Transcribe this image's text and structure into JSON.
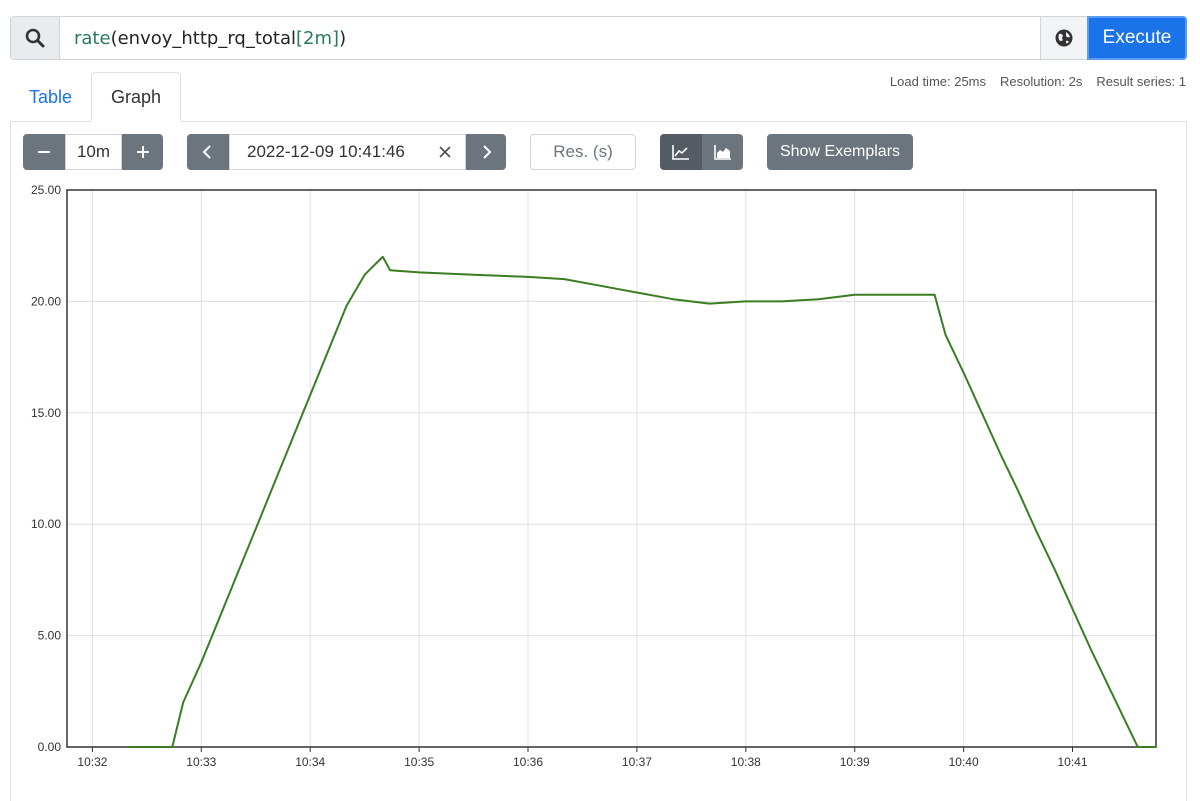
{
  "query": {
    "func": "rate",
    "open_paren": "(",
    "metric": "envoy_http_rq_total",
    "open_bracket": "[",
    "duration": "2m",
    "close_bracket": "]",
    "close_paren": ")"
  },
  "execute_label": "Execute",
  "tabs": {
    "table": "Table",
    "graph": "Graph"
  },
  "stats": {
    "load_time": "Load time: 25ms",
    "resolution": "Resolution: 2s",
    "result_series": "Result series: 1"
  },
  "controls": {
    "range_value": "10m",
    "end_time": "2022-12-09 10:41:46",
    "resolution_placeholder": "Res. (s)",
    "show_exemplars": "Show Exemplars"
  },
  "colors": {
    "series": "#3a7d22",
    "accent": "#1a73e8",
    "button": "#6c757d"
  },
  "chart_data": {
    "type": "line",
    "x_ticks": [
      "10:32",
      "10:33",
      "10:34",
      "10:35",
      "10:36",
      "10:37",
      "10:38",
      "10:39",
      "10:40",
      "10:41"
    ],
    "y_ticks": [
      "0.00",
      "5.00",
      "10.00",
      "15.00",
      "20.00",
      "25.00"
    ],
    "ylim": [
      0,
      25
    ],
    "xlim": [
      "10:31:46",
      "10:41:46"
    ],
    "grid": true,
    "series": [
      {
        "x": [
          "10:32:20",
          "10:32:44",
          "10:32:50",
          "10:33:00",
          "10:33:10",
          "10:33:20",
          "10:33:30",
          "10:33:40",
          "10:33:50",
          "10:34:00",
          "10:34:10",
          "10:34:20",
          "10:34:30",
          "10:34:40",
          "10:34:44",
          "10:35:00",
          "10:35:30",
          "10:36:00",
          "10:36:20",
          "10:36:40",
          "10:37:00",
          "10:37:20",
          "10:37:40",
          "10:38:00",
          "10:38:20",
          "10:38:40",
          "10:39:00",
          "10:39:20",
          "10:39:40",
          "10:39:44",
          "10:39:50",
          "10:40:00",
          "10:40:10",
          "10:40:20",
          "10:40:30",
          "10:40:40",
          "10:40:50",
          "10:41:00",
          "10:41:10",
          "10:41:20",
          "10:41:30",
          "10:41:36",
          "10:41:46"
        ],
        "y": [
          0,
          0,
          2.0,
          3.8,
          5.8,
          7.8,
          9.8,
          11.8,
          13.8,
          15.8,
          17.8,
          19.8,
          21.2,
          22.0,
          21.4,
          21.3,
          21.2,
          21.1,
          21.0,
          20.7,
          20.4,
          20.1,
          19.9,
          20.0,
          20.0,
          20.1,
          20.3,
          20.3,
          20.3,
          20.3,
          18.5,
          16.8,
          15.0,
          13.2,
          11.5,
          9.7,
          8.0,
          6.2,
          4.4,
          2.7,
          1.0,
          0,
          0
        ]
      }
    ]
  }
}
